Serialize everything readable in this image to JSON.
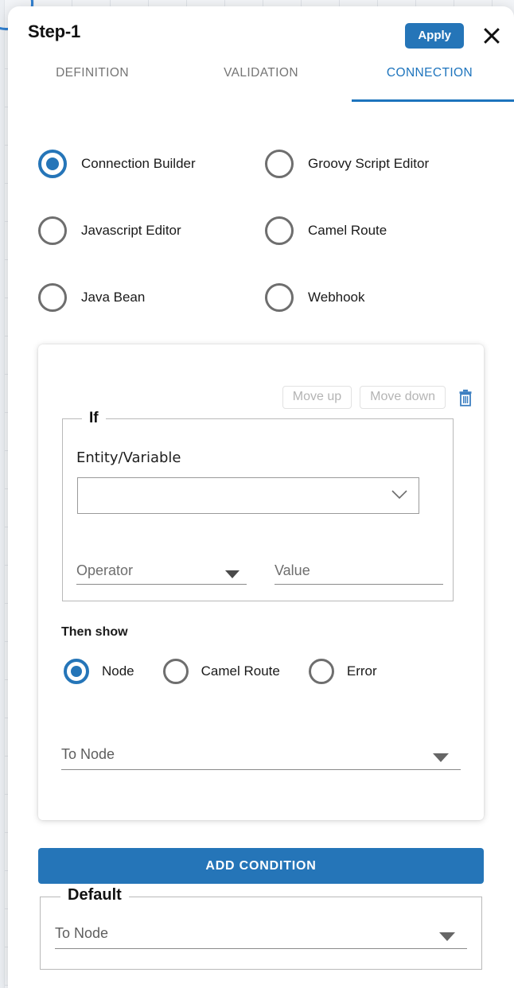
{
  "dialog": {
    "title": "Step-1",
    "apply_label": "Apply",
    "close_icon": "close-icon"
  },
  "tabs": [
    {
      "label": "DEFINITION",
      "active": false
    },
    {
      "label": "VALIDATION",
      "active": false
    },
    {
      "label": "CONNECTION",
      "active": true
    }
  ],
  "source_options": [
    {
      "label": "Connection Builder",
      "selected": true
    },
    {
      "label": "Groovy Script Editor",
      "selected": false
    },
    {
      "label": "Javascript Editor",
      "selected": false
    },
    {
      "label": "Camel Route",
      "selected": false
    },
    {
      "label": "Java Bean",
      "selected": false
    },
    {
      "label": "Webhook",
      "selected": false
    }
  ],
  "condition_card": {
    "move_up_label": "Move up",
    "move_down_label": "Move down",
    "delete_icon": "trash-icon",
    "if_legend": "If",
    "entity_variable_label": "Entity/Variable",
    "entity_variable_value": "",
    "entity_variable_icon": "chevron-down-icon",
    "operator_placeholder": "Operator",
    "operator_value": "",
    "operator_icon": "caret-down-icon",
    "value_placeholder": "Value",
    "value_value": "",
    "then_show_label": "Then show",
    "then_show_options": [
      {
        "label": "Node",
        "selected": true
      },
      {
        "label": "Camel Route",
        "selected": false
      },
      {
        "label": "Error",
        "selected": false
      }
    ],
    "to_node_placeholder": "To Node",
    "to_node_value": "",
    "to_node_icon": "caret-down-icon"
  },
  "add_condition_label": "ADD CONDITION",
  "default_section": {
    "legend": "Default",
    "to_node_placeholder": "To Node",
    "to_node_value": "",
    "to_node_icon": "caret-down-icon"
  },
  "colors": {
    "accent_blue": "#2575b8",
    "tab_active": "#1d74bd",
    "tab_inactive": "#757575",
    "radio_unselected": "#6e6e6e",
    "field_underline": "#8a8a8a",
    "card_border": "#b9b9b9"
  }
}
